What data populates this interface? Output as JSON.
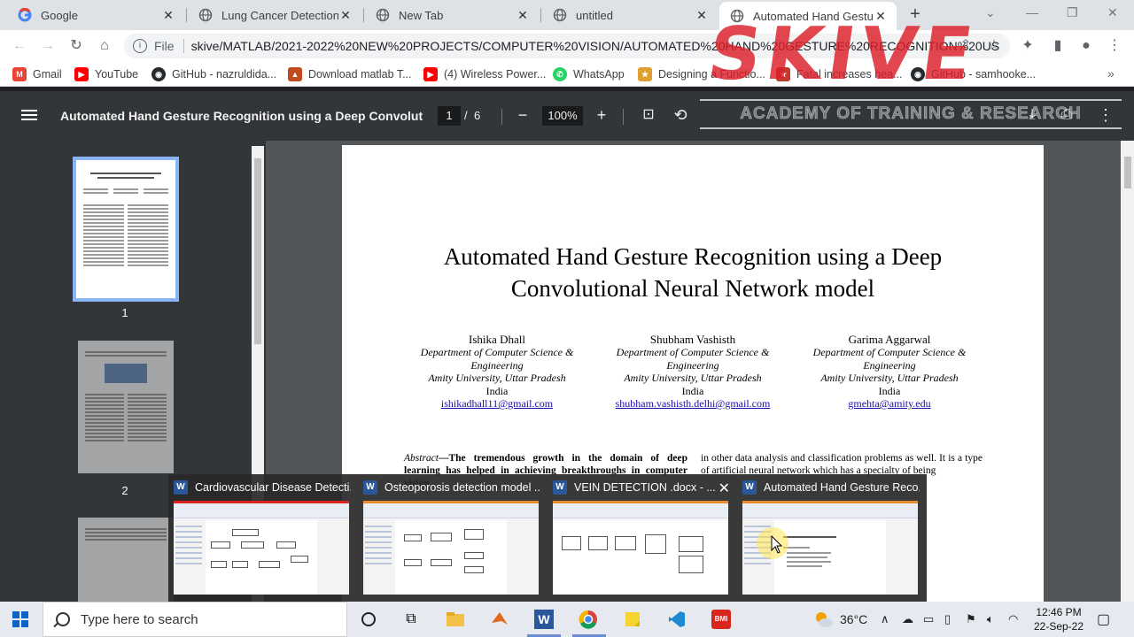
{
  "browser": {
    "tabs": [
      {
        "title": "Google",
        "icon": "google-icon"
      },
      {
        "title": "Lung Cancer Detection Us",
        "icon": "globe-icon"
      },
      {
        "title": "New Tab",
        "icon": "globe-icon"
      },
      {
        "title": "untitled",
        "icon": "globe-icon"
      },
      {
        "title": "Automated Hand Gesture",
        "icon": "globe-icon",
        "active": true
      }
    ],
    "omnibox_scheme": "File",
    "url": "skive/MATLAB/2021-2022%20NEW%20PROJECTS/COMPUTER%20VISION/AUTOMATED%20HAND%20GESTURE%20RECOGNITION%20US",
    "bookmarks": [
      {
        "label": "Gmail",
        "icon": "gmail-icon",
        "color": "#ea4335"
      },
      {
        "label": "YouTube",
        "icon": "youtube-icon",
        "color": "#ff0000"
      },
      {
        "label": "GitHub - nazruldida...",
        "icon": "github-icon",
        "color": "#24292e"
      },
      {
        "label": "Download matlab T...",
        "icon": "matlab-icon",
        "color": "#c04b1c"
      },
      {
        "label": "(4) Wireless Power...",
        "icon": "youtube-icon",
        "color": "#ff0000"
      },
      {
        "label": "WhatsApp",
        "icon": "whatsapp-icon",
        "color": "#25d366"
      },
      {
        "label": "Designing a Functio...",
        "icon": "bookmark-icon",
        "color": "#e0a030"
      },
      {
        "label": "Fatal increases hea...",
        "icon": "bookmark-icon",
        "color": "#c0392b"
      },
      {
        "label": "GitHub - samhooke...",
        "icon": "github-icon",
        "color": "#24292e"
      }
    ]
  },
  "pdf": {
    "title": "Automated Hand Gesture Recognition using a Deep Convolutio...",
    "page_current": "1",
    "page_sep": "/",
    "page_total": "6",
    "zoom": "100%",
    "thumbnails": [
      {
        "num": "1"
      },
      {
        "num": "2"
      }
    ]
  },
  "paper": {
    "title_line1": "Automated Hand Gesture Recognition using a Deep",
    "title_line2": "Convolutional Neural Network model",
    "authors": [
      {
        "name": "Ishika Dhall",
        "dept1": "Department of Computer Science &",
        "dept2": "Engineering",
        "univ": "Amity University, Uttar Pradesh",
        "country": "India",
        "email": "ishikadhall11@gmail.com"
      },
      {
        "name": "Shubham Vashisth",
        "dept1": "Department of Computer Science &",
        "dept2": "Engineering",
        "univ": "Amity University, Uttar Pradesh",
        "country": "India",
        "email": "shubham.vashisth.delhi@gmail.com"
      },
      {
        "name": "Garima Aggarwal",
        "dept1": "Department of Computer Science &",
        "dept2": "Engineering",
        "univ": "Amity University, Uttar Pradesh",
        "country": "India",
        "email": "gmehta@amity.edu"
      }
    ],
    "abstract_label": "Abstract",
    "abstract_text": "—The tremendous growth in the domain of deep learning has helped in achieving breakthroughs in computer vision",
    "col2_text": "in other data analysis and classification problems as well. It is a type of artificial neural network which has a specialty of being"
  },
  "watermark": {
    "logo": "SKIVE",
    "tagline": "ACADEMY OF TRAINING & RESEARCH"
  },
  "taskbar_previews": [
    {
      "title": "Cardiovascular Disease Detecti...",
      "app": "word-icon"
    },
    {
      "title": "Osteoporosis detection model ...",
      "app": "word-icon"
    },
    {
      "title": "VEIN DETECTION .docx - ...",
      "app": "word-icon"
    },
    {
      "title": "Automated Hand Gesture Reco...",
      "app": "word-icon"
    }
  ],
  "taskbar": {
    "search_placeholder": "Type here to search",
    "weather": "36°C",
    "time": "12:46 PM",
    "date": "22-Sep-22"
  }
}
